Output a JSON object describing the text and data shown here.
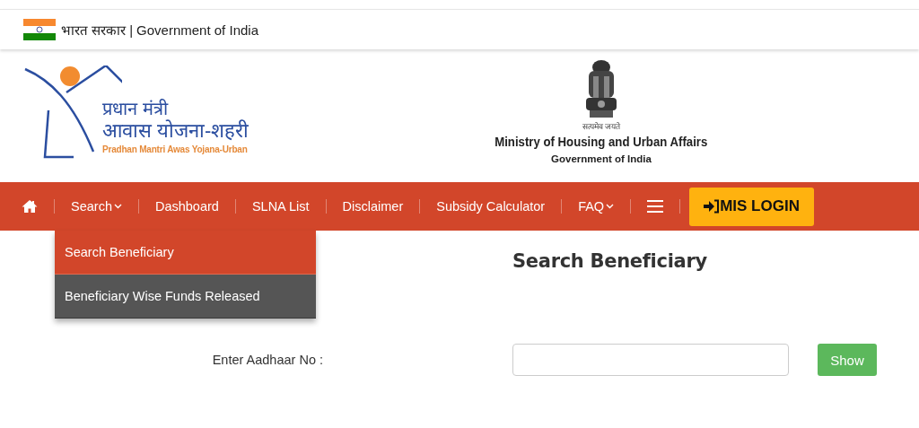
{
  "gov_bar": {
    "hindi": "भारत सरकार",
    "separator": "|",
    "english": "Government of India"
  },
  "header": {
    "logo": {
      "line1": "प्रधान मंत्री",
      "line2": "आवास योजना-शहरी",
      "subtitle": "Pradhan Mantri Awas Yojana-Urban"
    },
    "emblem_motto": "सत्यमेव जयते",
    "ministry": "Ministry of Housing and Urban Affairs",
    "government": "Government of India"
  },
  "nav": [
    {
      "kind": "home"
    },
    {
      "kind": "link",
      "label": "Search",
      "caret": true,
      "expanded": true,
      "children": [
        {
          "label": "Search Beneficiary",
          "selected": true
        },
        {
          "label": "Beneficiary Wise Funds Released",
          "selected": false
        }
      ]
    },
    {
      "kind": "link",
      "label": "Dashboard"
    },
    {
      "kind": "link",
      "label": "SLNA List"
    },
    {
      "kind": "link",
      "label": "Disclaimer"
    },
    {
      "kind": "link",
      "label": "Subsidy Calculator"
    },
    {
      "kind": "link",
      "label": "FAQ",
      "caret": true
    },
    {
      "kind": "menu"
    },
    {
      "kind": "login",
      "label": "MIS LOGIN"
    }
  ],
  "main": {
    "title": "Search Beneficiary",
    "field_label": "Enter Aadhaar No :",
    "button": "Show"
  }
}
